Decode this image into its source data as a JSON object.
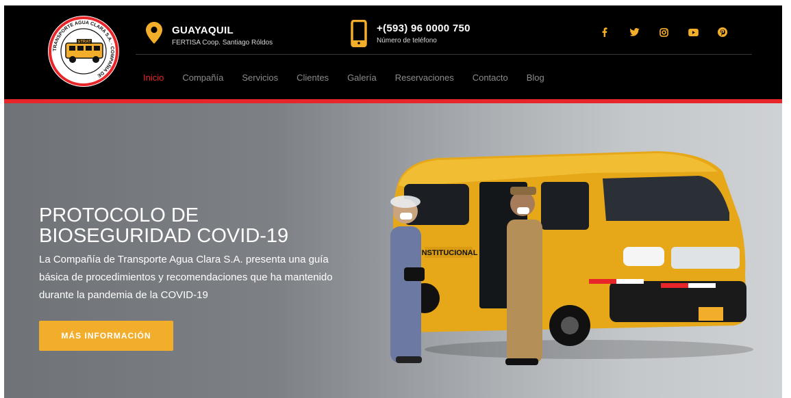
{
  "logo": {
    "ring_text": "TRANSPORTE AGUA CLARA S.A. · COMPAÑIA DE",
    "badge": "STRAT"
  },
  "contact": {
    "location_title": "GUAYAQUIL",
    "location_sub": "FERTISA Coop. Santiago Róldos",
    "phone_title": "+(593) 96 0000 750",
    "phone_sub": "Número de teléfono"
  },
  "social": [
    "facebook-icon",
    "twitter-icon",
    "instagram-icon",
    "youtube-icon",
    "pinterest-icon"
  ],
  "nav": {
    "items": [
      {
        "label": "Inicio",
        "active": true
      },
      {
        "label": "Compañía"
      },
      {
        "label": "Servicios"
      },
      {
        "label": "Clientes"
      },
      {
        "label": "Galería"
      },
      {
        "label": "Reservaciones"
      },
      {
        "label": "Contacto"
      },
      {
        "label": "Blog"
      }
    ]
  },
  "hero": {
    "title": "PROTOCOLO DE BIOSEGURIDAD COVID-19",
    "text": "La Compañía de Transporte Agua Clara S.A. presenta una guía básica de procedimientos y recomendaciones que ha mantenido durante la pandemia de la COVID-19",
    "cta": "MÁS INFORMACIÓN",
    "van_side_text": "INSTITUCIONAL"
  },
  "colors": {
    "accent_red": "#e8262a",
    "accent_orange": "#f2ad2b",
    "header_bg": "#000000"
  }
}
